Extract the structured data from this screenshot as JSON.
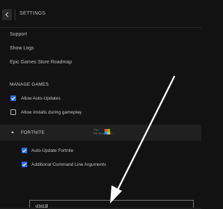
{
  "header": {
    "title": "SETTINGS",
    "back_icon": "chevron-left-icon"
  },
  "links": [
    "Support",
    "Show Logs",
    "Epic Games Store Roadmap"
  ],
  "manage_games": {
    "title": "MANAGE GAMES",
    "options": [
      {
        "label": "Allow Auto-Updates",
        "checked": true
      },
      {
        "label": "Allow installs during gameplay",
        "checked": false
      }
    ]
  },
  "game": {
    "name": "FORTNITE",
    "expanded": true,
    "options": [
      {
        "label": "Auto-Update Fortnite",
        "checked": true
      },
      {
        "label": "Additional Command Line Arguments",
        "checked": true
      }
    ],
    "args_value": "d3d11"
  },
  "watermark": {
    "line1": "The",
    "line2": "WindowsClub"
  },
  "colors": {
    "background": "#121212",
    "accent": "#2f6fd8",
    "row_highlight": "#202020",
    "arrow": "#ffffff"
  }
}
